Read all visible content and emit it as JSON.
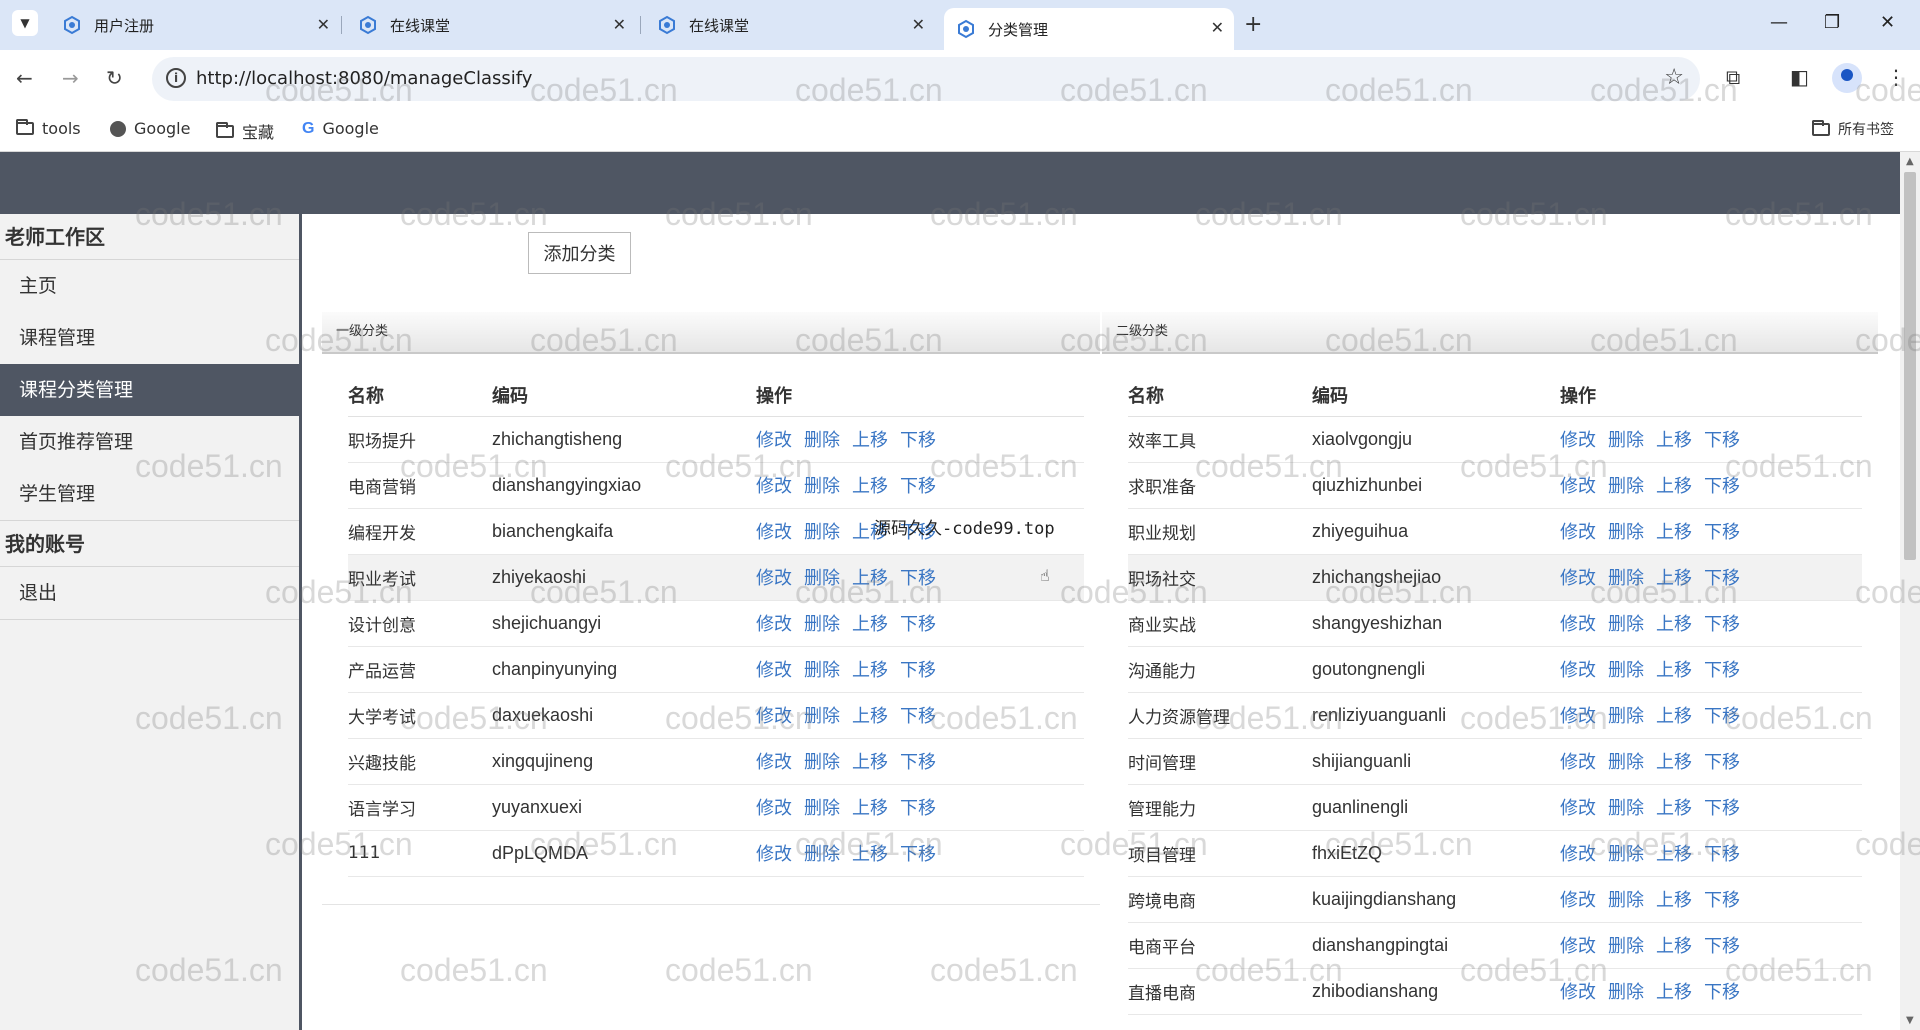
{
  "browser": {
    "tabs": [
      {
        "title": "用户注册"
      },
      {
        "title": "在线课堂"
      },
      {
        "title": "在线课堂"
      },
      {
        "title": "分类管理"
      }
    ],
    "url": "http://localhost:8080/manageClassify",
    "bookmarks": [
      {
        "label": "tools",
        "icon": "folder-icon"
      },
      {
        "label": "Google",
        "icon": "globe-icon"
      },
      {
        "label": "宝藏",
        "icon": "folder-icon"
      },
      {
        "label": "Google",
        "icon": "google-icon"
      }
    ],
    "all_bookmarks": "所有书签"
  },
  "sidebar": {
    "teacher_section": "老师工作区",
    "teacher_items": [
      {
        "label": "主页"
      },
      {
        "label": "课程管理"
      },
      {
        "label": "课程分类管理"
      },
      {
        "label": "首页推荐管理"
      },
      {
        "label": "学生管理"
      }
    ],
    "account_section": "我的账号",
    "account_items": [
      {
        "label": "退出"
      }
    ]
  },
  "main": {
    "add_button": "添加分类",
    "columns": {
      "name": "名称",
      "code": "编码",
      "ops": "操作"
    },
    "ops": {
      "edit": "修改",
      "delete": "删除",
      "up": "上移",
      "down": "下移"
    },
    "level1": {
      "title": "一级分类",
      "rows": [
        {
          "name": "职场提升",
          "code": "zhichangtisheng"
        },
        {
          "name": "电商营销",
          "code": "dianshangyingxiao"
        },
        {
          "name": "编程开发",
          "code": "bianchengkaifa"
        },
        {
          "name": "职业考试",
          "code": "zhiyekaoshi"
        },
        {
          "name": "设计创意",
          "code": "shejichuangyi"
        },
        {
          "name": "产品运营",
          "code": "chanpinyunying"
        },
        {
          "name": "大学考试",
          "code": "daxuekaoshi"
        },
        {
          "name": "兴趣技能",
          "code": "xingqujineng"
        },
        {
          "name": "语言学习",
          "code": "yuyanxuexi"
        },
        {
          "name": "111",
          "code": "dPpLQMDA"
        }
      ]
    },
    "level2": {
      "title": "二级分类",
      "rows": [
        {
          "name": "效率工具",
          "code": "xiaolvgongju"
        },
        {
          "name": "求职准备",
          "code": "qiuzhizhunbei"
        },
        {
          "name": "职业规划",
          "code": "zhiyeguihua"
        },
        {
          "name": "职场社交",
          "code": "zhichangshejiao"
        },
        {
          "name": "商业实战",
          "code": "shangyeshizhan"
        },
        {
          "name": "沟通能力",
          "code": "goutongnengli"
        },
        {
          "name": "人力资源管理",
          "code": "renliziyuanguanli"
        },
        {
          "name": "时间管理",
          "code": "shijianguanli"
        },
        {
          "name": "管理能力",
          "code": "guanlinengli"
        },
        {
          "name": "项目管理",
          "code": "fhxiEtZQ"
        },
        {
          "name": "跨境电商",
          "code": "kuaijingdianshang"
        },
        {
          "name": "电商平台",
          "code": "dianshangpingtai"
        },
        {
          "name": "直播电商",
          "code": "zhibodianshang"
        }
      ]
    }
  },
  "overlay_text": "源码久久-code99.top",
  "watermark": "code51.cn",
  "colors": {
    "header": "#4f5663",
    "link": "#3a76c4",
    "tabbar": "#dbe6f7"
  }
}
